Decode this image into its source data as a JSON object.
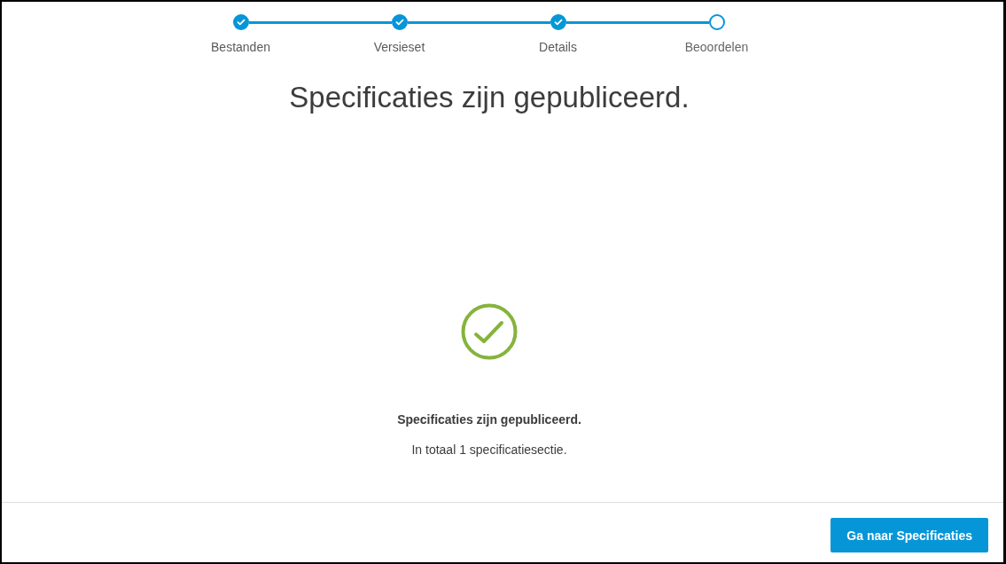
{
  "steps": [
    {
      "label": "Bestanden",
      "completed": true
    },
    {
      "label": "Versieset",
      "completed": true
    },
    {
      "label": "Details",
      "completed": true
    },
    {
      "label": "Beoordelen",
      "completed": false
    }
  ],
  "title": "Specificaties zijn gepubliceerd.",
  "result": {
    "heading": "Specificaties zijn gepubliceerd.",
    "message": "In totaal 1 specificatiesectie."
  },
  "footer": {
    "button": "Ga naar Specificaties"
  }
}
